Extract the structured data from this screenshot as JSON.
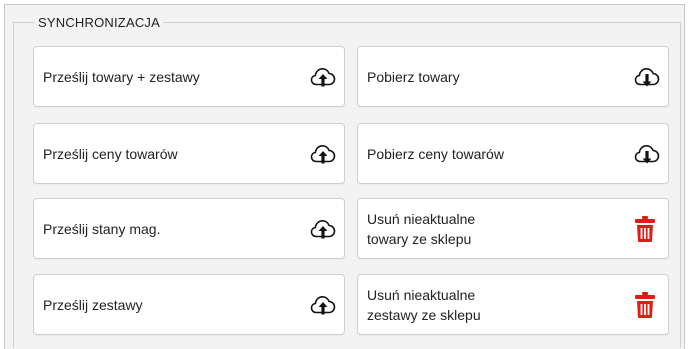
{
  "group_title": "SYNCHRONIZACJA",
  "colors": {
    "icon_dark": "#111111",
    "trash_red": "#e31b17"
  },
  "buttons": {
    "upload_products_sets": {
      "label": "Prześlij towary + zestawy",
      "icon": "cloud-upload-icon"
    },
    "download_products": {
      "label": "Pobierz towary",
      "icon": "cloud-download-icon"
    },
    "upload_prices": {
      "label": "Prześlij ceny towarów",
      "icon": "cloud-upload-icon"
    },
    "download_prices": {
      "label": "Pobierz ceny towarów",
      "icon": "cloud-download-icon"
    },
    "upload_stock": {
      "label": "Prześlij stany mag.",
      "icon": "cloud-upload-icon"
    },
    "delete_outdated_products": {
      "label": "Usuń nieaktualne\ntowary ze sklepu",
      "icon": "trash-icon"
    },
    "upload_sets": {
      "label": "Prześlij zestawy",
      "icon": "cloud-upload-icon"
    },
    "delete_outdated_sets": {
      "label": "Usuń nieaktualne\nzestawy ze sklepu",
      "icon": "trash-icon"
    }
  }
}
